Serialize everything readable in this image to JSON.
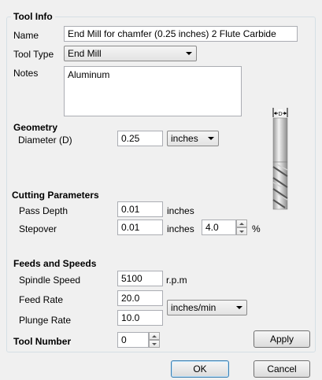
{
  "group": {
    "legend": "Tool Info"
  },
  "name": {
    "label": "Name",
    "value": "End Mill for chamfer (0.25 inches) 2 Flute Carbide"
  },
  "tool_type": {
    "label": "Tool Type",
    "value": "End Mill"
  },
  "notes": {
    "label": "Notes",
    "value": "Aluminum"
  },
  "geometry": {
    "heading": "Geometry",
    "diameter_label": "Diameter (D)",
    "diameter_value": "0.25",
    "units_value": "inches",
    "diagram_label": "D"
  },
  "cutting": {
    "heading": "Cutting Parameters",
    "pass_depth_label": "Pass Depth",
    "pass_depth_value": "0.01",
    "pass_depth_unit": "inches",
    "stepover_label": "Stepover",
    "stepover_value": "0.01",
    "stepover_unit": "inches",
    "stepover_percent": "4.0",
    "percent_symbol": "%"
  },
  "feeds": {
    "heading": "Feeds and Speeds",
    "spindle_label": "Spindle Speed",
    "spindle_value": "5100",
    "spindle_unit": "r.p.m",
    "feed_label": "Feed Rate",
    "feed_value": "20.0",
    "plunge_label": "Plunge Rate",
    "plunge_value": "10.0",
    "rate_units": "inches/min"
  },
  "tool_number": {
    "label": "Tool Number",
    "value": "0"
  },
  "buttons": {
    "apply": "Apply",
    "ok": "OK",
    "cancel": "Cancel"
  }
}
